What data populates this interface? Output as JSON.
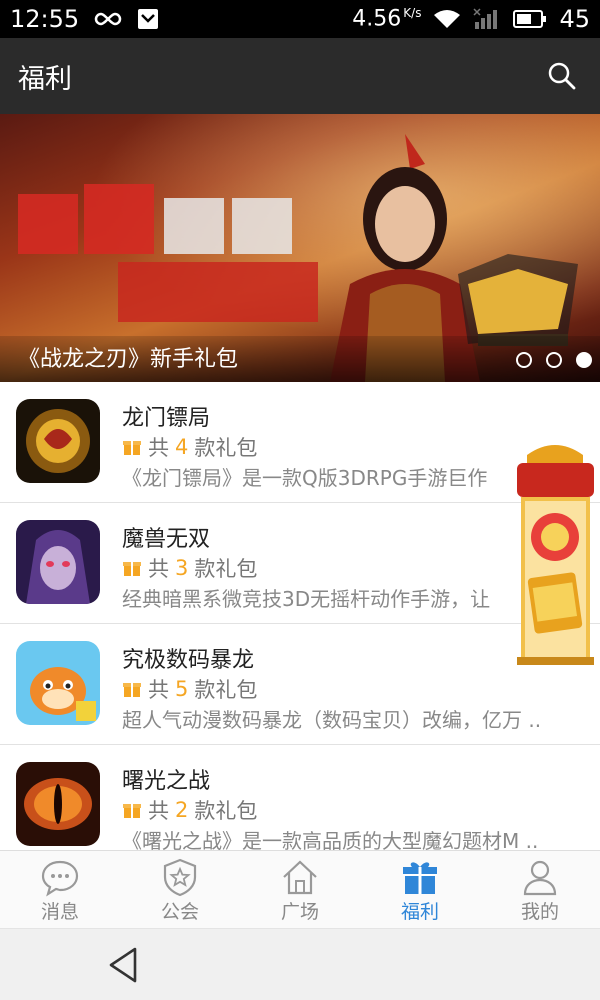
{
  "status_bar": {
    "time": "12:55",
    "network_speed": "4.56",
    "network_unit": "K/s",
    "battery": "45"
  },
  "app_bar": {
    "title": "福利"
  },
  "banner": {
    "caption": "《战龙之刃》新手礼包",
    "slide_count": 3,
    "active_slide": 3
  },
  "games": [
    {
      "name": "龙门镖局",
      "gift_prefix": "共",
      "gift_count": "4",
      "gift_suffix": "款礼包",
      "description": "《龙门镖局》是一款Q版3DRPG手游巨作"
    },
    {
      "name": "魔兽无双",
      "gift_prefix": "共",
      "gift_count": "3",
      "gift_suffix": "款礼包",
      "description": "经典暗黑系微竞技3D无摇杆动作手游，让"
    },
    {
      "name": "究极数码暴龙",
      "gift_prefix": "共",
      "gift_count": "5",
      "gift_suffix": "款礼包",
      "description": "超人气动漫数码暴龙（数码宝贝）改编，亿万 .."
    },
    {
      "name": "曙光之战",
      "gift_prefix": "共",
      "gift_count": "2",
      "gift_suffix": "款礼包",
      "description": "《曙光之战》是一款高品质的大型魔幻题材M .."
    }
  ],
  "tabs": [
    {
      "label": "消息",
      "icon": "chat-icon"
    },
    {
      "label": "公会",
      "icon": "shield-star-icon"
    },
    {
      "label": "广场",
      "icon": "home-icon"
    },
    {
      "label": "福利",
      "icon": "gift-icon",
      "active": true
    },
    {
      "label": "我的",
      "icon": "person-icon"
    }
  ],
  "colors": {
    "accent": "#2f86d8",
    "gift_count": "#f5a623",
    "app_bar": "#2b2b2b"
  }
}
